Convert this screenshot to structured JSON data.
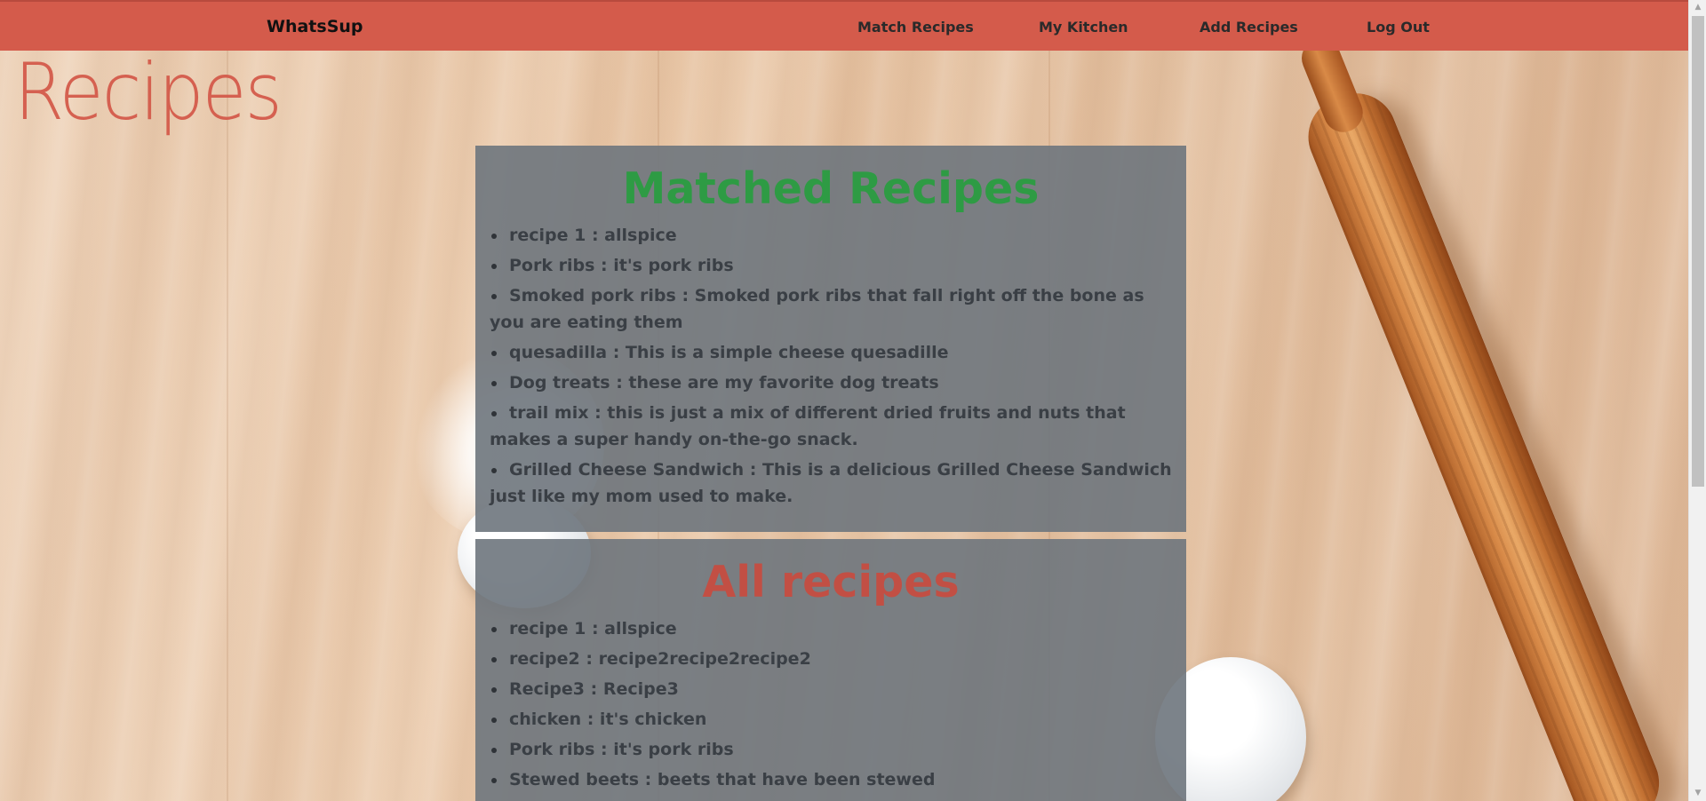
{
  "navbar": {
    "brand": "WhatsSup",
    "links": {
      "match": "Match Recipes",
      "kitchen": "My Kitchen",
      "add": "Add Recipes",
      "logout": "Log Out"
    },
    "color": "#d45b4b"
  },
  "page": {
    "title": "Recipes",
    "title_color": "#d45b4b"
  },
  "matched": {
    "heading": "Matched Recipes",
    "heading_color": "#2e9b44",
    "items": [
      "recipe 1 : allspice",
      "Pork ribs : it's pork ribs",
      "Smoked pork ribs : Smoked pork ribs that fall right off the bone as you are eating them",
      "quesadilla : This is a simple cheese quesadille",
      "Dog treats : these are my favorite dog treats",
      "trail mix : this is just a mix of different dried fruits and nuts that makes a super handy on-the-go snack.",
      "Grilled Cheese Sandwich : This is a delicious Grilled Cheese Sandwich just like my mom used to make."
    ]
  },
  "all": {
    "heading": "All recipes",
    "heading_color": "#c24f44",
    "items": [
      "recipe 1 : allspice",
      "recipe2 : recipe2recipe2recipe2",
      "Recipe3 : Recipe3",
      "chicken : it's chicken",
      "Pork ribs : it's pork ribs",
      "Stewed beets : beets that have been stewed"
    ]
  },
  "icons": {
    "scroll_up": "scroll-up-arrow-icon",
    "scroll_down": "scroll-down-arrow-icon"
  }
}
